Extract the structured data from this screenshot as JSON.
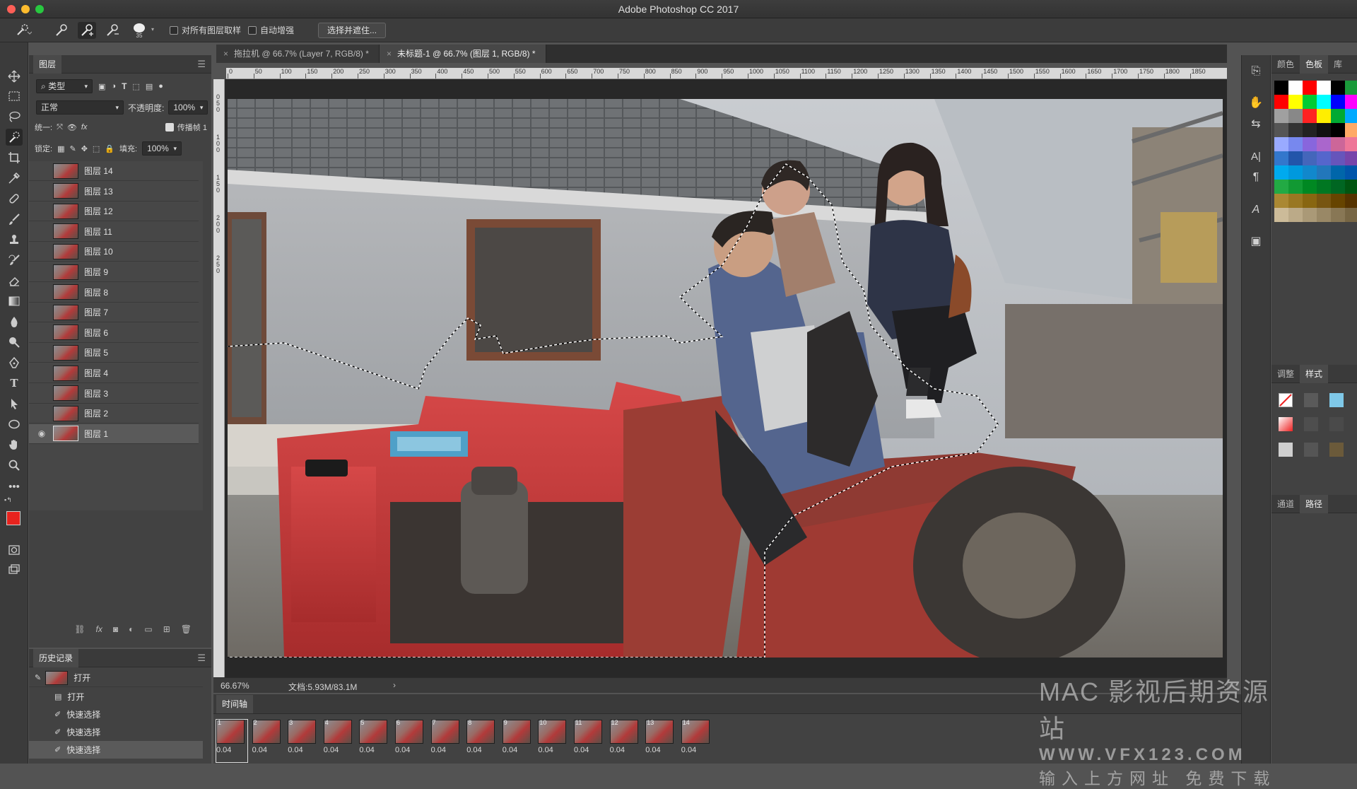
{
  "app": {
    "title": "Adobe Photoshop CC 2017"
  },
  "options_bar": {
    "brush_size": "35",
    "sample_all_layers": "对所有图层取样",
    "auto_enhance": "自动增强",
    "select_mask_button": "选择并遮住..."
  },
  "layers_panel": {
    "tab": "图层",
    "filter_kind": "类型",
    "blend_mode": "正常",
    "opacity_label": "不透明度:",
    "opacity_value": "100%",
    "unify_label": "统一:",
    "propagate_label": "传播帧 1",
    "lock_label": "锁定:",
    "fill_label": "填充:",
    "fill_value": "100%",
    "layers": [
      {
        "name": "图层 14"
      },
      {
        "name": "图层 13"
      },
      {
        "name": "图层 12"
      },
      {
        "name": "图层 11"
      },
      {
        "name": "图层 10"
      },
      {
        "name": "图层 9"
      },
      {
        "name": "图层 8"
      },
      {
        "name": "图层 7"
      },
      {
        "name": "图层 6"
      },
      {
        "name": "图层 5"
      },
      {
        "name": "图层 4"
      },
      {
        "name": "图层 3"
      },
      {
        "name": "图层 2"
      },
      {
        "name": "图层 1",
        "selected": true,
        "visible": true
      }
    ]
  },
  "history_panel": {
    "tab": "历史记录",
    "snapshot": "打开",
    "items": [
      "打开",
      "快速选择",
      "快速选择",
      "快速选择"
    ]
  },
  "document_tabs": [
    {
      "label": "拖拉机 @ 66.7% (Layer 7, RGB/8) *"
    },
    {
      "label": "未标题-1 @ 66.7% (图层 1, RGB/8) *",
      "active": true
    }
  ],
  "ruler_ticks": [
    "0",
    "50",
    "100",
    "150",
    "200",
    "250",
    "300",
    "350",
    "400",
    "450",
    "500",
    "550",
    "600",
    "650",
    "700",
    "750",
    "800",
    "850",
    "900",
    "950",
    "1000",
    "1050",
    "1100",
    "1150",
    "1200",
    "1250",
    "1300",
    "1350",
    "1400",
    "1450",
    "1500",
    "1550",
    "1600",
    "1650",
    "1700",
    "1750",
    "1800",
    "1850"
  ],
  "ruler_left_ticks": [
    "0",
    "5",
    "0",
    "1",
    "0",
    "0",
    "1",
    "5",
    "0",
    "2",
    "0",
    "0",
    "2",
    "5",
    "0"
  ],
  "status": {
    "zoom": "66.67%",
    "doc": "文档:5.93M/83.1M"
  },
  "timeline": {
    "tab": "时间轴",
    "frames": [
      {
        "n": "1",
        "delay": "0.04"
      },
      {
        "n": "2",
        "delay": "0.04"
      },
      {
        "n": "3",
        "delay": "0.04"
      },
      {
        "n": "4",
        "delay": "0.04"
      },
      {
        "n": "5",
        "delay": "0.04"
      },
      {
        "n": "6",
        "delay": "0.04"
      },
      {
        "n": "7",
        "delay": "0.04"
      },
      {
        "n": "8",
        "delay": "0.04"
      },
      {
        "n": "9",
        "delay": "0.04"
      },
      {
        "n": "10",
        "delay": "0.04"
      },
      {
        "n": "11",
        "delay": "0.04"
      },
      {
        "n": "12",
        "delay": "0.04"
      },
      {
        "n": "13",
        "delay": "0.04"
      },
      {
        "n": "14",
        "delay": "0.04"
      }
    ]
  },
  "right_panels": {
    "color_tabs": [
      "颜色",
      "色板",
      "库"
    ],
    "adjust_tabs": [
      "调整",
      "样式"
    ],
    "channels_tabs": [
      "通道",
      "路径"
    ]
  },
  "foreground_color": "#e8231e",
  "background_color": "#ffffff",
  "watermark": {
    "line1": "MAC 影视后期资源站",
    "line2": "WWW.VFX123.COM",
    "line3": "输入上方网址 免费下载"
  }
}
